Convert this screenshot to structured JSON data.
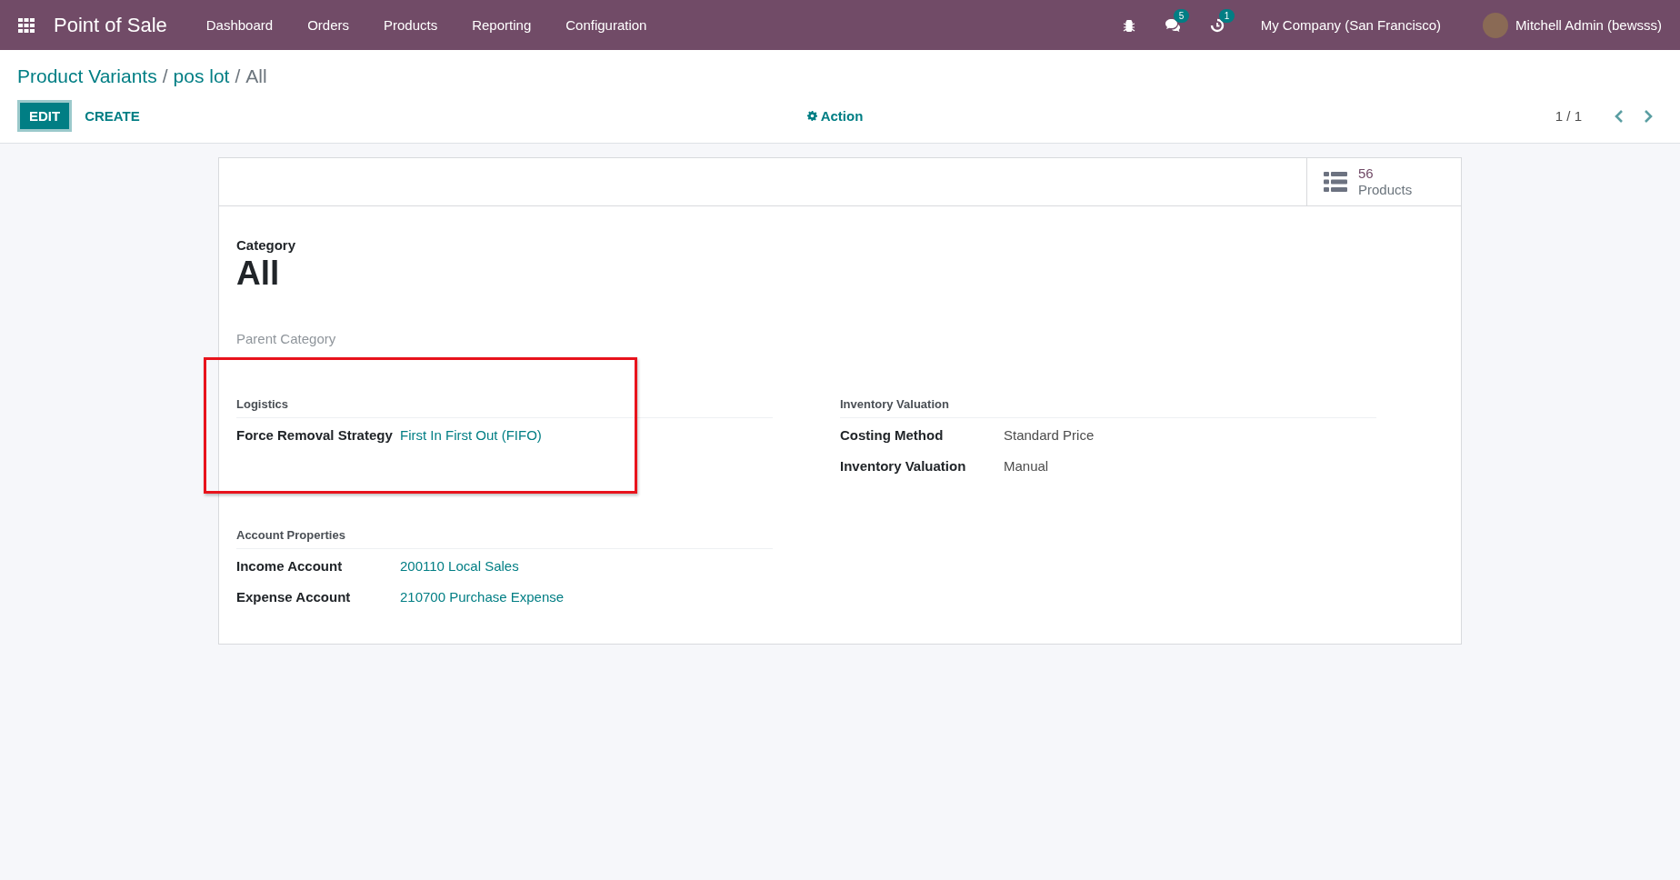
{
  "navbar": {
    "app_name": "Point of Sale",
    "menu": [
      "Dashboard",
      "Orders",
      "Products",
      "Reporting",
      "Configuration"
    ],
    "messages_badge": "5",
    "activities_badge": "1",
    "company": "My Company (San Francisco)",
    "user": "Mitchell Admin (bewsss)"
  },
  "breadcrumb": {
    "links": [
      "Product Variants",
      "pos lot"
    ],
    "separator": "/",
    "current": "All"
  },
  "buttons": {
    "edit": "EDIT",
    "create": "CREATE",
    "action": "Action"
  },
  "pager": "1 / 1",
  "smart_button": {
    "count": "56",
    "label": "Products"
  },
  "form": {
    "category_label": "Category",
    "name": "All",
    "parent_placeholder": "Parent Category",
    "groups": [
      {
        "title": "Logistics",
        "highlighted": true,
        "fields": [
          {
            "label": "Force Removal Strategy",
            "value": "First In First Out (FIFO)",
            "kind": "link"
          }
        ]
      },
      {
        "title": "Inventory Valuation",
        "highlighted": false,
        "fields": [
          {
            "label": "Costing Method",
            "value": "Standard Price",
            "kind": "text"
          },
          {
            "label": "Inventory Valuation",
            "value": "Manual",
            "kind": "text"
          }
        ]
      },
      {
        "title": "Account Properties",
        "highlighted": false,
        "fields": [
          {
            "label": "Income Account",
            "value": "200110 Local Sales",
            "kind": "link"
          },
          {
            "label": "Expense Account",
            "value": "210700 Purchase Expense",
            "kind": "link"
          }
        ]
      }
    ]
  }
}
